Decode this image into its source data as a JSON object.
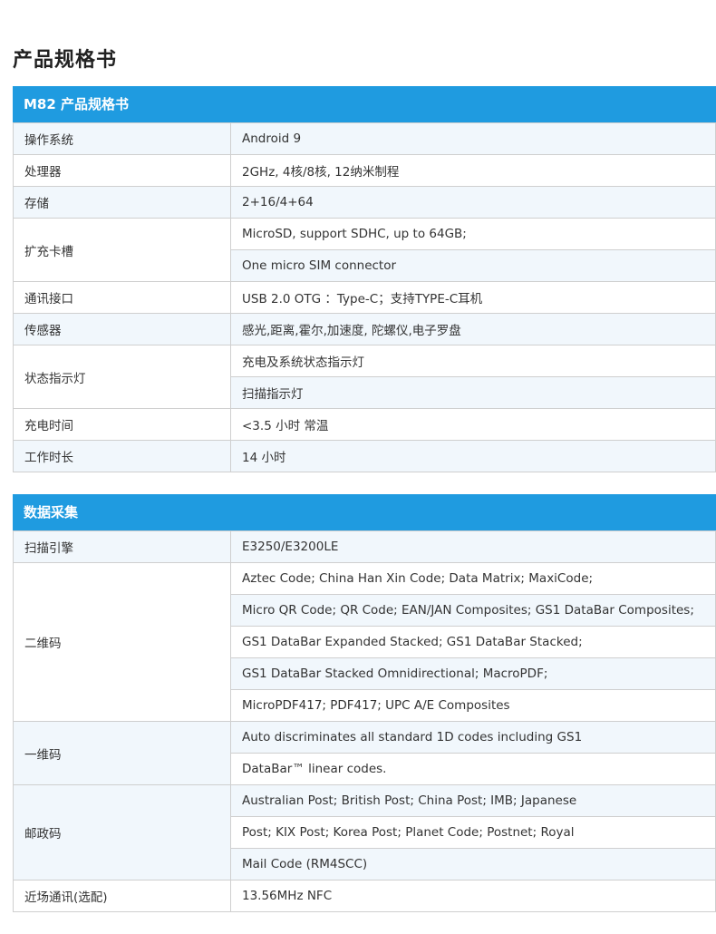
{
  "page_title": "产品规格书",
  "sections": [
    {
      "title": "M82 产品规格书",
      "rows": [
        {
          "key": "操作系统",
          "values": [
            "Android 9"
          ]
        },
        {
          "key": "处理器",
          "values": [
            "2GHz, 4核/8核, 12纳米制程"
          ]
        },
        {
          "key": "存储",
          "values": [
            "2+16/4+64"
          ]
        },
        {
          "key": "扩充卡槽",
          "values": [
            "MicroSD,  support SDHC, up to 64GB;",
            "One micro SIM  connector"
          ]
        },
        {
          "key": "通讯接口",
          "values": [
            "USB 2.0 OTG ：Type-C；支持TYPE-C耳机"
          ]
        },
        {
          "key": "传感器",
          "values": [
            "感光,距离,霍尔,加速度, 陀螺仪,电子罗盘"
          ]
        },
        {
          "key": "状态指示灯",
          "values": [
            "充电及系统状态指示灯",
            "扫描指示灯"
          ]
        },
        {
          "key": "充电时间",
          "values": [
            "<3.5 小时   常温"
          ]
        },
        {
          "key": "工作时长",
          "values": [
            "14 小时"
          ]
        }
      ]
    },
    {
      "title": "数据采集",
      "rows": [
        {
          "key": "扫描引擎",
          "values": [
            "E3250/E3200LE"
          ]
        },
        {
          "key": "二维码",
          "values": [
            "Aztec Code; China Han Xin Code; Data Matrix; MaxiCode;",
            "Micro QR Code; QR Code; EAN/JAN Composites; GS1 DataBar Composites;",
            "GS1 DataBar Expanded Stacked; GS1 DataBar Stacked;",
            "GS1 DataBar Stacked Omnidirectional; MacroPDF;",
            "MicroPDF417; PDF417; UPC A/E Composites"
          ]
        },
        {
          "key": "一维码",
          "values": [
            "Auto discriminates all standard 1D codes including GS1",
            "DataBar™ linear codes."
          ]
        },
        {
          "key": "邮政码",
          "values": [
            "Australian Post; British Post; China Post; IMB; Japanese",
            "Post; KIX Post; Korea Post; Planet Code; Postnet; Royal",
            "Mail Code (RM4SCC)"
          ]
        },
        {
          "key": "近场通讯(选配)",
          "values": [
            "13.56MHz NFC"
          ]
        }
      ]
    }
  ],
  "colors": {
    "header_bg": "#1f9be0",
    "stripe_bg": "#f1f7fc",
    "border": "#cfcfcf"
  }
}
